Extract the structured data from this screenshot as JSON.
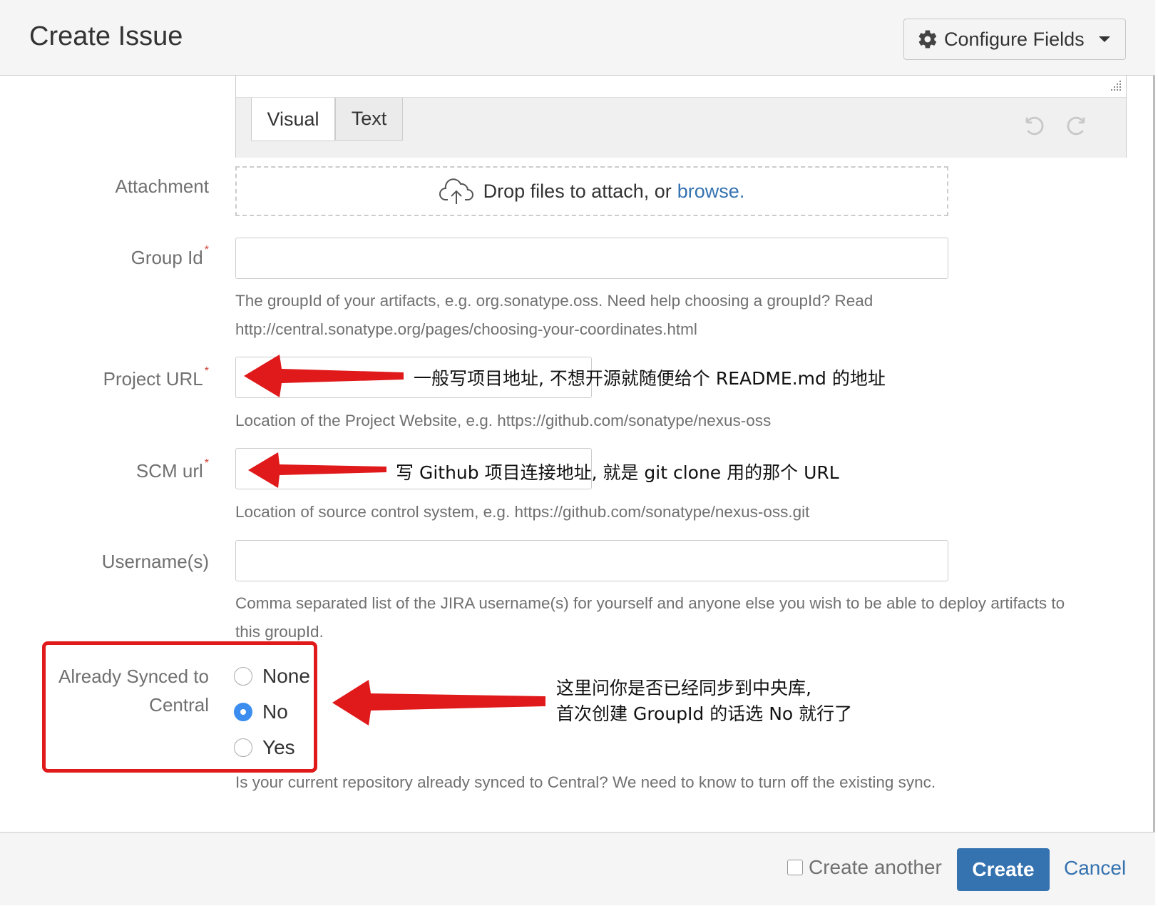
{
  "header": {
    "title": "Create Issue",
    "configure_label": "Configure Fields"
  },
  "editor": {
    "tab_visual": "Visual",
    "tab_text": "Text"
  },
  "attachment": {
    "label": "Attachment",
    "drop_text": "Drop files to attach, or",
    "browse_link": "browse."
  },
  "group_id": {
    "label": "Group Id",
    "required_mark": "*",
    "help_line1": "The groupId of your artifacts, e.g. org.sonatype.oss. Need help choosing a groupId? Read",
    "help_line2": "http://central.sonatype.org/pages/choosing-your-coordinates.html"
  },
  "project_url": {
    "label": "Project URL",
    "required_mark": "*",
    "help": "Location of the Project Website, e.g. https://github.com/sonatype/nexus-oss"
  },
  "scm_url": {
    "label": "SCM url",
    "required_mark": "*",
    "help": "Location of source control system, e.g. https://github.com/sonatype/nexus-oss.git"
  },
  "usernames": {
    "label": "Username(s)",
    "help_line1": "Comma separated list of the JIRA username(s) for yourself and anyone else you wish to be able to deploy artifacts to",
    "help_line2": "this groupId."
  },
  "synced": {
    "label_line1": "Already Synced to",
    "label_line2": "Central",
    "options": [
      "None",
      "No",
      "Yes"
    ],
    "selected": "No",
    "help": "Is your current repository already synced to Central? We need to know to turn off the existing sync."
  },
  "annotations": {
    "project_url": "一般写项目地址, 不想开源就随便给个 README.md 的地址",
    "scm_url": "写 Github 项目连接地址, 就是 git clone 用的那个 URL",
    "synced_line1": "这里问你是否已经同步到中央库,",
    "synced_line2": "首次创建 GroupId 的话选 No 就行了"
  },
  "footer": {
    "create_another": "Create another",
    "create": "Create",
    "cancel": "Cancel"
  },
  "colors": {
    "accent": "#3572b0",
    "annotation_red": "#e0191b",
    "radio_selected": "#3b8ef0"
  },
  "icons": [
    "gear-icon",
    "chevron-down-icon",
    "undo-icon",
    "redo-icon",
    "cloud-upload-icon",
    "resize-grip-icon",
    "arrow-annotation-icon"
  ]
}
